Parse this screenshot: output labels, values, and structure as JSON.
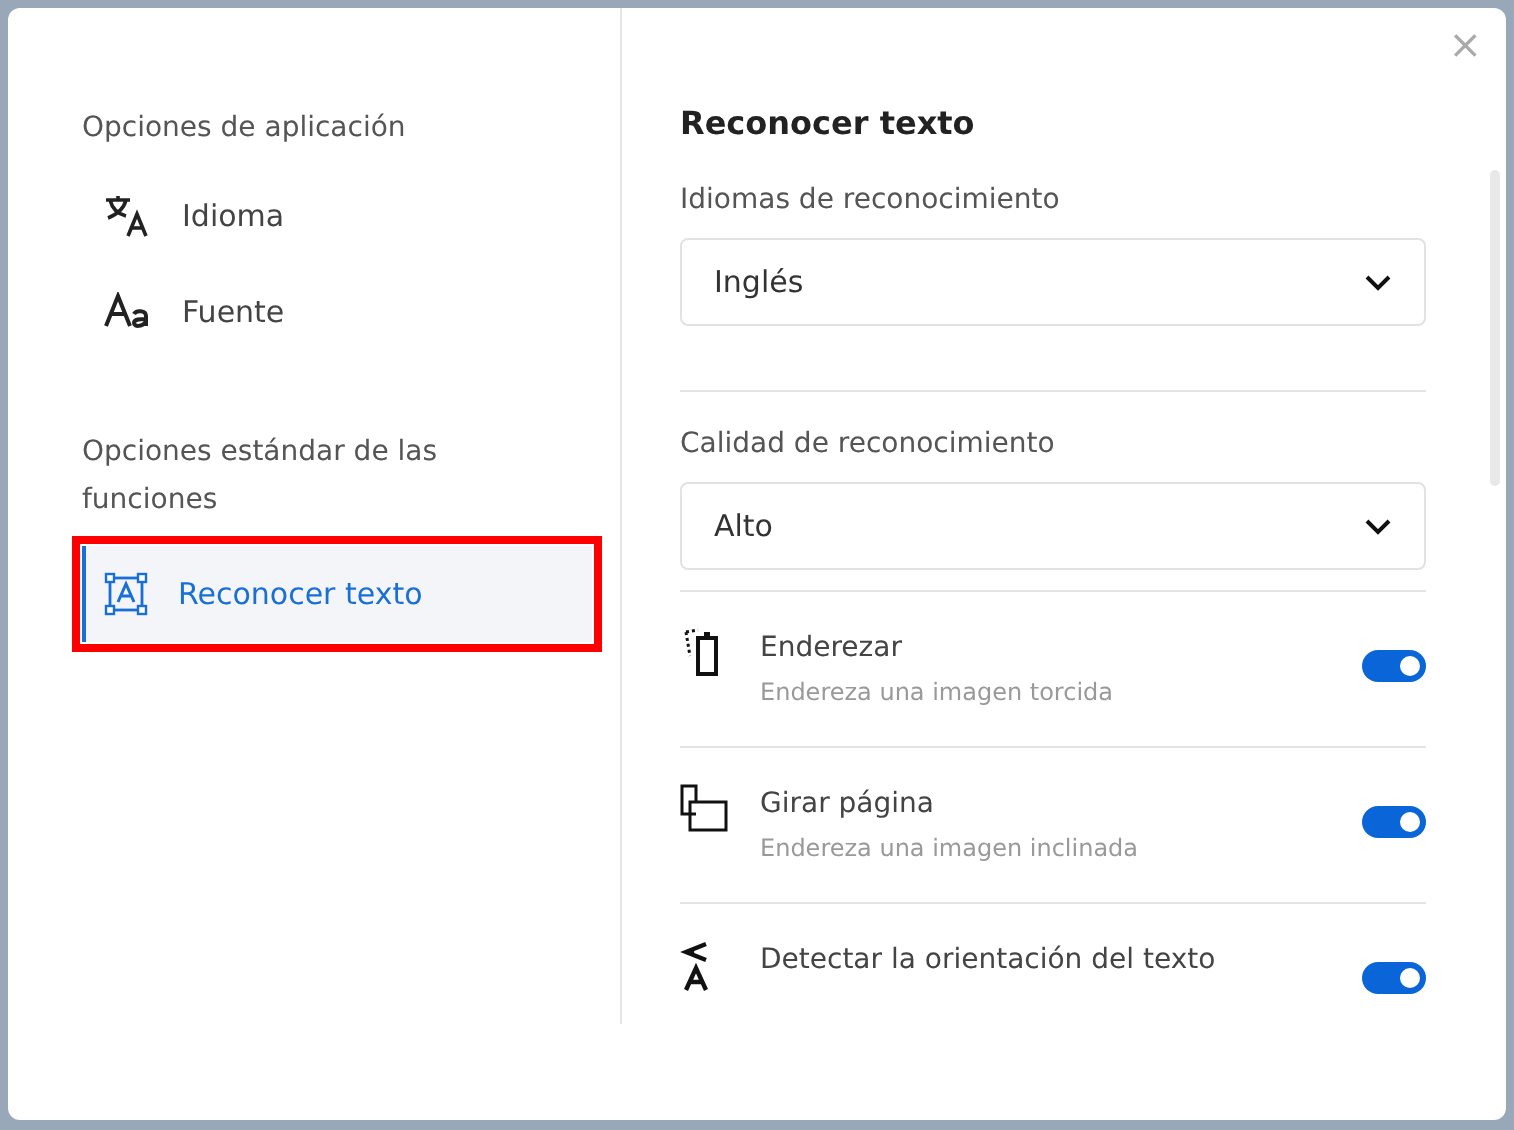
{
  "close": "×",
  "sidebar": {
    "sections": [
      {
        "title": "Opciones de aplicación",
        "items": [
          {
            "label": "Idioma",
            "kind": "translate",
            "selected": false
          },
          {
            "label": "Fuente",
            "kind": "font",
            "selected": false
          }
        ]
      },
      {
        "title": "Opciones estándar de las funciones",
        "items": [
          {
            "label": "Reconocer texto",
            "kind": "ocr",
            "selected": true
          }
        ]
      }
    ]
  },
  "content": {
    "title": "Reconocer texto",
    "selects": [
      {
        "label": "Idiomas de reconocimiento",
        "value": "Inglés"
      },
      {
        "label": "Calidad de reconocimiento",
        "value": "Alto"
      }
    ],
    "toggles": [
      {
        "kind": "deskew",
        "title": "Enderezar",
        "description": "Endereza una imagen torcida",
        "on": true
      },
      {
        "kind": "rotate",
        "title": "Girar página",
        "description": "Endereza una imagen inclinada",
        "on": true
      },
      {
        "kind": "orientation",
        "title": "Detectar la orientación del texto",
        "on": true
      }
    ]
  }
}
